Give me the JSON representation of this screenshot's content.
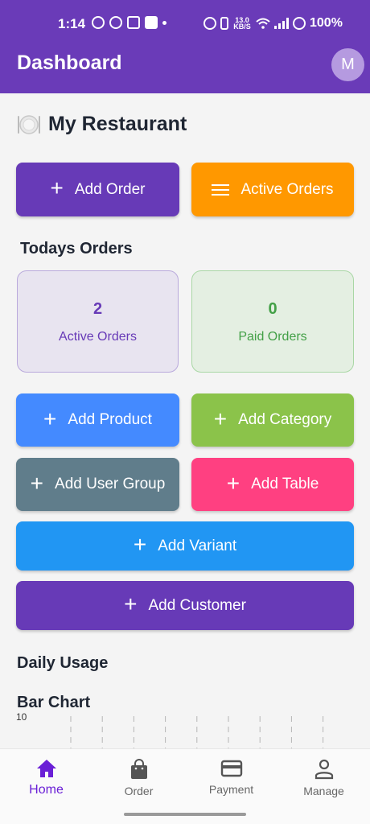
{
  "status_bar": {
    "time": "1:14",
    "speed": "13.0 KB/S",
    "battery": "100%",
    "icons": [
      "whatsapp-icon",
      "messenger-icon",
      "instagram-icon",
      "youtube-icon",
      "dot-icon",
      "alarm-icon",
      "vibrate-icon",
      "wifi-icon",
      "signal-icon",
      "battery-icon"
    ]
  },
  "appbar": {
    "title": "Dashboard",
    "avatar_initial": "M",
    "color": "#6a3bb8"
  },
  "restaurant": {
    "name": "My Restaurant",
    "icon": "plate-cutlery-icon"
  },
  "quick_actions": {
    "add_order": "Add Order",
    "active_orders": "Active Orders"
  },
  "todays_orders": {
    "title": "Todays Orders",
    "active": {
      "count": "2",
      "label": "Active Orders"
    },
    "paid": {
      "count": "0",
      "label": "Paid Orders"
    }
  },
  "actions": {
    "add_product": "Add Product",
    "add_category": "Add Category",
    "add_user_group": "Add User Group",
    "add_table": "Add Table",
    "add_variant": "Add Variant",
    "add_customer": "Add Customer"
  },
  "colors": {
    "purple": "#673ab7",
    "orange": "#ff9800",
    "blue": "#448aff",
    "green": "#8bc34a",
    "slate": "#607d8b",
    "pink": "#ff4081",
    "sky": "#2196f3",
    "active_card_bg": "#e8e4f0",
    "paid_card_bg": "#e4efe2",
    "paid_text": "#43a047"
  },
  "daily_usage": {
    "title": "Daily Usage",
    "chart_title": "Bar Chart"
  },
  "chart_data": {
    "type": "bar",
    "title": "Bar Chart",
    "y_tick_labels": [
      "10"
    ],
    "ylim": [
      0,
      10
    ],
    "grid": true,
    "categories": [],
    "values": []
  },
  "bottom_nav": {
    "items": [
      {
        "label": "Home",
        "icon": "home-icon",
        "active": true
      },
      {
        "label": "Order",
        "icon": "shopping-bag-icon",
        "active": false
      },
      {
        "label": "Payment",
        "icon": "credit-card-icon",
        "active": false
      },
      {
        "label": "Manage",
        "icon": "person-icon",
        "active": false
      }
    ]
  }
}
